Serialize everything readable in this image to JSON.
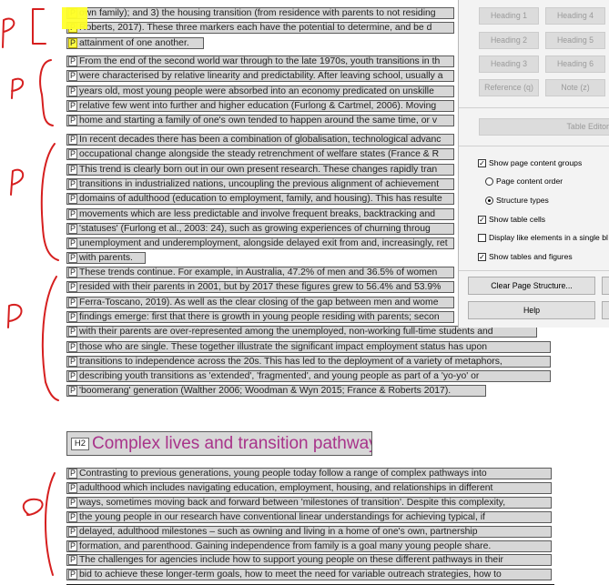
{
  "document": {
    "blocks": [
      {
        "lines": [
          "own family); and 3) the housing transition (from residence with parents to not residing",
          "Roberts, 2017). These three markers each have the potential to determine, and be d",
          "attainment of one another."
        ]
      },
      {
        "lines": [
          "From the end of the second world war through to the late 1970s, youth transitions in th",
          "were characterised by relative linearity and predictability. After leaving school, usually a",
          "years old, most young people were absorbed into an economy predicated on unskille",
          "relative few went into further and higher education (Furlong & Cartmel, 2006). Moving",
          "home and starting a family of one's own tended to happen around the same time, or v"
        ]
      },
      {
        "lines": [
          "In recent decades there has been a combination of globalisation, technological advanc",
          "occupational change alongside the steady retrenchment of welfare states (France & R",
          "This trend is clearly born out in our own present research. These changes rapidly tran",
          "transitions in industrialized nations, uncoupling the previous alignment of achievement",
          "domains of adulthood (education to employment, family, and housing). This has resulte",
          "movements which are less predictable and involve frequent breaks, backtracking and",
          "'statuses' (Furlong et al., 2003: 24), such as growing experiences of churning throug",
          "unemployment and underemployment, alongside delayed exit from and, increasingly, ret",
          "with parents."
        ]
      },
      {
        "lines": [
          "These trends continue. For example, in Australia, 47.2% of men and 36.5% of women",
          "resided with their parents in 2001, but by 2017 these figures grew to 56.4% and 53.9%",
          "Ferra-Toscano, 2019). As well as the clear closing of the gap between men and wome",
          "findings emerge: first that there is growth in young people residing with parents; secon",
          "with their parents are over-represented among the unemployed, non-working full-time students and",
          "those who are single. These together illustrate the significant impact employment status has upon",
          "transitions to independence across the 20s. This has led to the deployment of a variety of metaphors,",
          "describing youth transitions as 'extended', 'fragmented', and young people as part of a 'yo-yo' or",
          "'boomerang' generation (Walther 2006; Woodman & Wyn 2015; France & Roberts 2017)."
        ]
      },
      {
        "lines": [
          "Contrasting to previous generations, young people today follow a range of complex pathways into",
          "adulthood which includes navigating education, employment, housing, and relationships in different",
          "ways, sometimes moving back and forward between 'milestones of transition'. Despite this complexity,",
          "the young people in our research have conventional linear understandings for achieving typical, if",
          "delayed, adulthood milestones – such as owning and living in a home of one's own, partnership",
          "formation, and parenthood. Gaining independence from family is a goal many young people share.",
          "The challenges for agencies include how to support young people on these different pathways in their",
          "bid to achieve these longer-term goals, how to meet the need for variable outreach strategies, how to"
        ]
      }
    ],
    "heading": {
      "tag": "H2",
      "text": "Complex lives and transition pathways"
    },
    "p_tag": "P"
  },
  "panel": {
    "headings": [
      "Heading 1",
      "Heading 4",
      "Heading 2",
      "Heading 5",
      "Heading 3",
      "Heading 6"
    ],
    "reference": "Reference (q)",
    "note": "Note (z)",
    "table_editor": "Table Editor",
    "options": {
      "show_page_content_groups": "Show page content groups",
      "page_content_order": "Page content order",
      "structure_types": "Structure types",
      "show_table_cells": "Show table cells",
      "display_like_elements": "Display like elements in a single bl",
      "show_tables_figures": "Show tables and figures"
    },
    "clear_structure": "Clear Page Structure...",
    "help": "Help"
  }
}
